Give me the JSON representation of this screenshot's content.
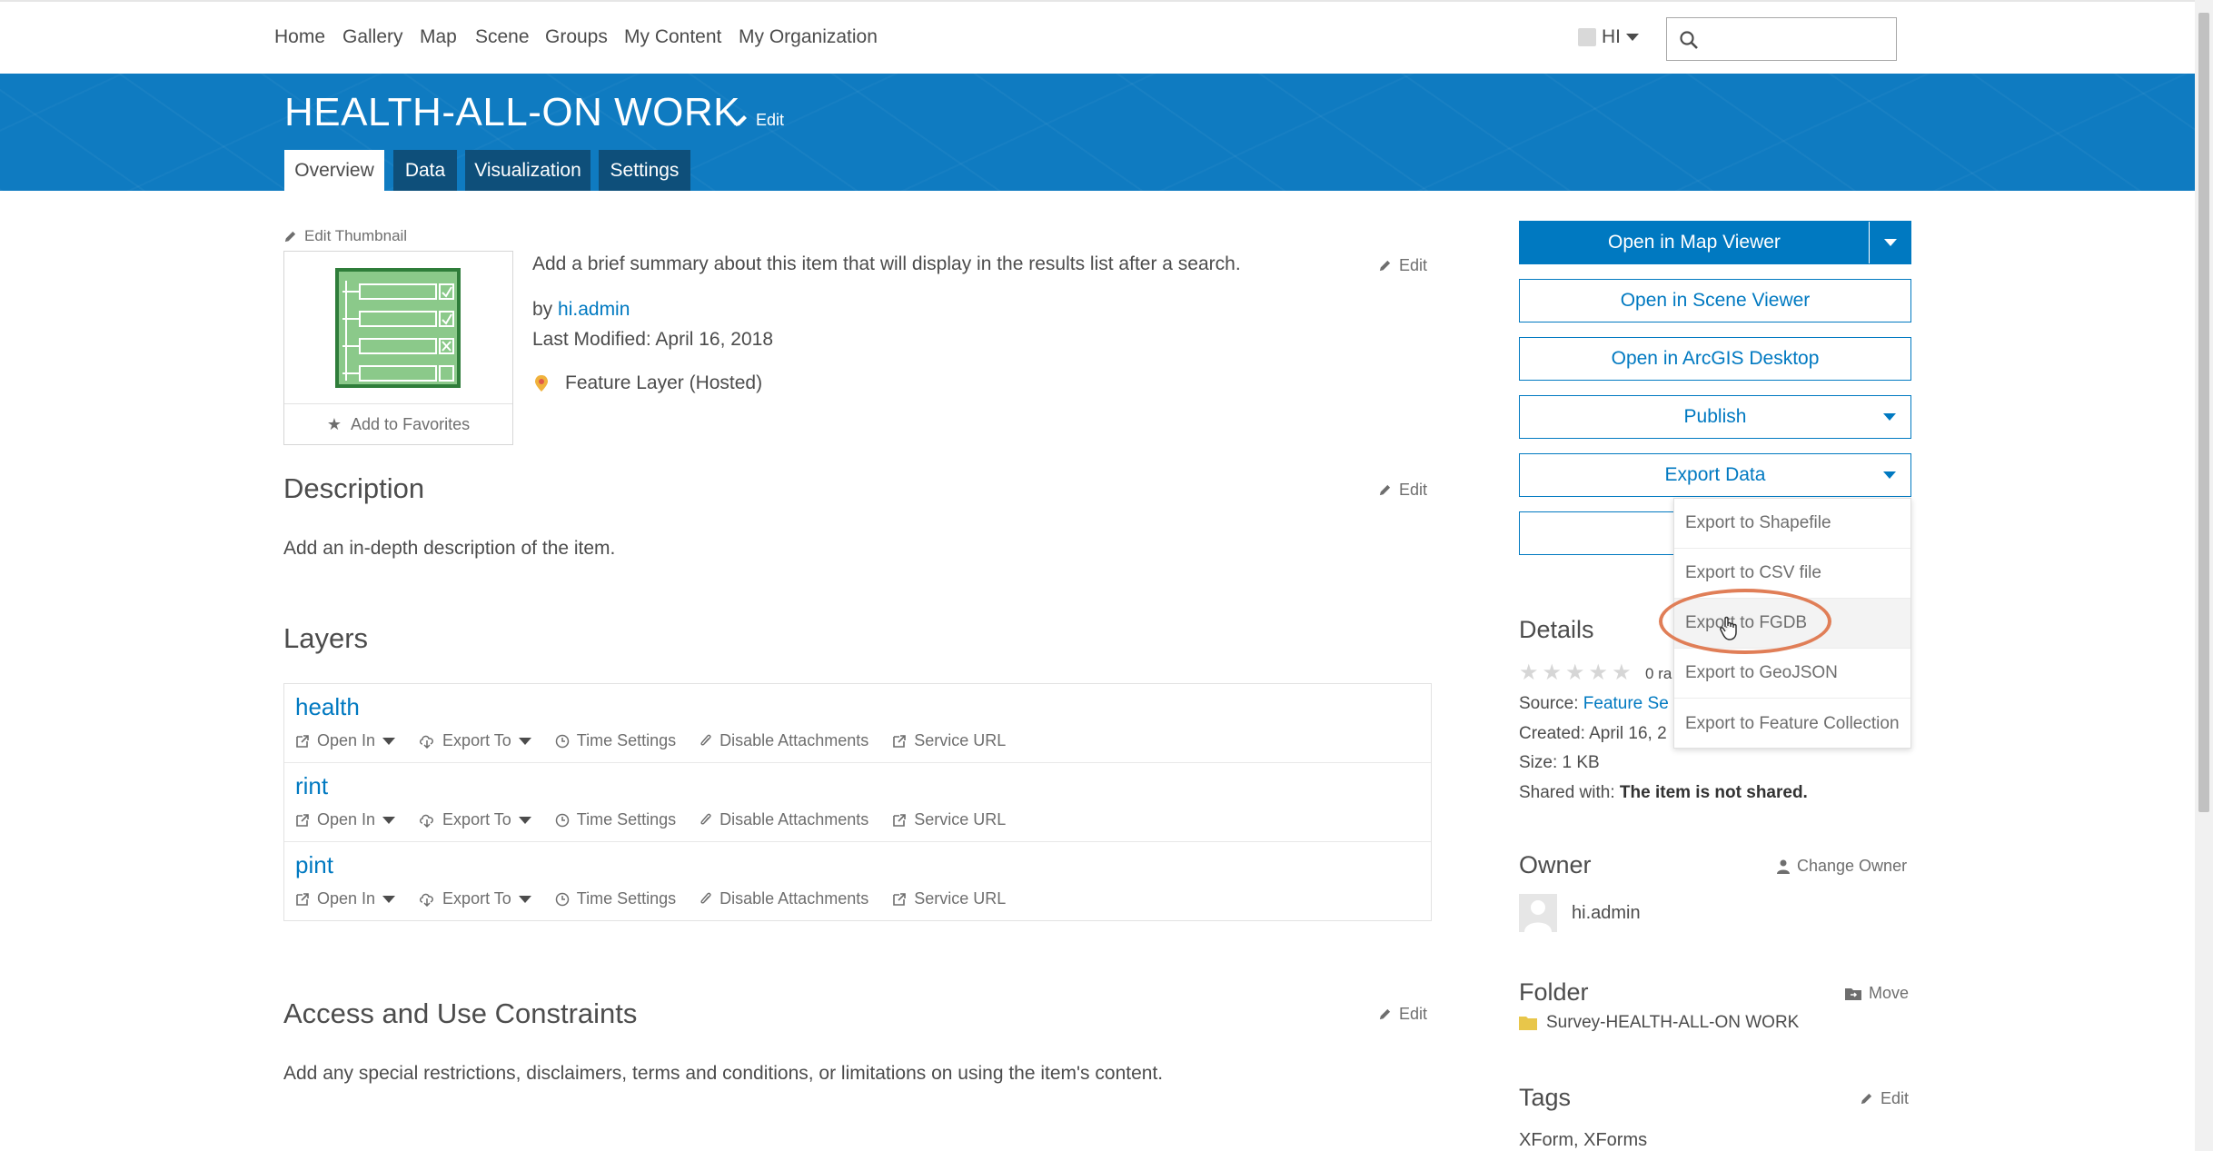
{
  "nav": {
    "items": [
      "Home",
      "Gallery",
      "Map",
      "Scene",
      "Groups",
      "My Content",
      "My Organization"
    ],
    "user_initials": "HI",
    "search_placeholder": ""
  },
  "header": {
    "title": "HEALTH-ALL-ON WORK",
    "edit_label": "Edit",
    "tabs": [
      "Overview",
      "Data",
      "Visualization",
      "Settings"
    ],
    "active_tab": "Overview"
  },
  "overview": {
    "edit_thumbnail": "Edit Thumbnail",
    "add_to_favorites": "Add to Favorites",
    "summary_placeholder": "Add a brief summary about this item that will display in the results list after a search.",
    "summary_edit": "Edit",
    "by_label": "by",
    "owner_link": "hi.admin",
    "last_modified": "Last Modified: April 16, 2018",
    "item_type": "Feature Layer (Hosted)"
  },
  "description": {
    "heading": "Description",
    "edit": "Edit",
    "placeholder": "Add an in-depth description of the item."
  },
  "layers": {
    "heading": "Layers",
    "items": [
      {
        "name": "health"
      },
      {
        "name": "rint"
      },
      {
        "name": "pint"
      }
    ],
    "actions": {
      "open_in": "Open In",
      "export_to": "Export To",
      "time_settings": "Time Settings",
      "disable_attachments": "Disable Attachments",
      "service_url": "Service URL"
    }
  },
  "constraints": {
    "heading": "Access and Use Constraints",
    "edit": "Edit",
    "placeholder": "Add any special restrictions, disclaimers, terms and conditions, or limitations on using the item's content."
  },
  "actions": {
    "open_map_viewer": "Open in Map Viewer",
    "open_scene_viewer": "Open in Scene Viewer",
    "open_arcgis_desktop": "Open in ArcGIS Desktop",
    "publish": "Publish",
    "export_data": "Export Data",
    "export_menu": [
      "Export to Shapefile",
      "Export to CSV file",
      "Export to FGDB",
      "Export to GeoJSON",
      "Export to Feature Collection"
    ],
    "hovered_export": "Export to FGDB"
  },
  "details": {
    "heading": "Details",
    "ratings_partial": "0 ra",
    "source_label": "Source:",
    "source_value": "Feature Se",
    "created": "Created: April 16, 2",
    "size": "Size: 1 KB",
    "shared_label": "Shared with:",
    "shared_value": "The item is not shared."
  },
  "owner": {
    "heading": "Owner",
    "change_owner": "Change Owner",
    "name": "hi.admin"
  },
  "folder": {
    "heading": "Folder",
    "move": "Move",
    "name": "Survey-HEALTH-ALL-ON WORK"
  },
  "tags": {
    "heading": "Tags",
    "edit": "Edit",
    "values": "XForm, XForms"
  },
  "colors": {
    "banner": "#0f7bc1",
    "link": "#0079c1",
    "highlight": "#e07e57"
  }
}
